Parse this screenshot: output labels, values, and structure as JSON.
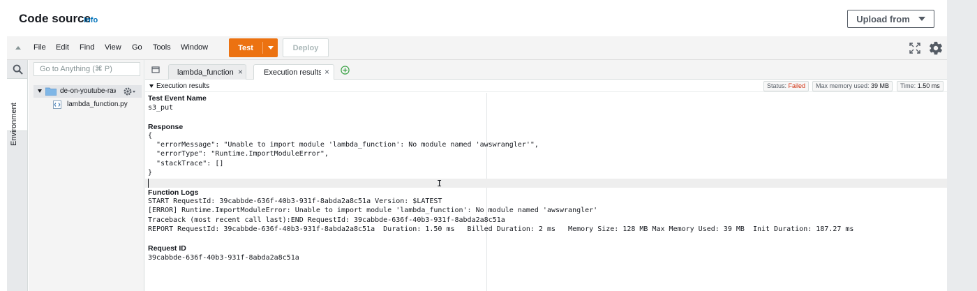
{
  "header": {
    "title": "Code source",
    "info": "Info",
    "upload_label": "Upload from"
  },
  "menubar": {
    "items": [
      "File",
      "Edit",
      "Find",
      "View",
      "Go",
      "Tools",
      "Window"
    ],
    "test_label": "Test",
    "deploy_label": "Deploy"
  },
  "sidebar": {
    "environment_label": "Environment",
    "goto_placeholder": "Go to Anything (⌘ P)",
    "folder_name": "de-on-youtube-raw-",
    "file_name": "lambda_function.py"
  },
  "tabs": [
    {
      "label": "lambda_function"
    },
    {
      "label": "Execution results"
    }
  ],
  "results": {
    "title": "Execution results",
    "status_label": "Status:",
    "status_value": "Failed",
    "memory_label": "Max memory used:",
    "memory_value": "39 MB",
    "time_label": "Time:",
    "time_value": "1.50 ms"
  },
  "output": {
    "test_event_heading": "Test Event Name",
    "test_event_value": "s3_put",
    "response_heading": "Response",
    "response_lines": [
      "{",
      "  \"errorMessage\": \"Unable to import module 'lambda_function': No module named 'awswrangler'\",",
      "  \"errorType\": \"Runtime.ImportModuleError\",",
      "  \"stackTrace\": []",
      "}"
    ],
    "function_logs_heading": "Function Logs",
    "log_lines": [
      "START RequestId: 39cabbde-636f-40b3-931f-8abda2a8c51a Version: $LATEST",
      "[ERROR] Runtime.ImportModuleError: Unable to import module 'lambda_function': No module named 'awswrangler'",
      "Traceback (most recent call last):END RequestId: 39cabbde-636f-40b3-931f-8abda2a8c51a",
      "REPORT RequestId: 39cabbde-636f-40b3-931f-8abda2a8c51a  Duration: 1.50 ms   Billed Duration: 2 ms   Memory Size: 128 MB Max Memory Used: 39 MB  Init Duration: 187.27 ms"
    ],
    "request_id_heading": "Request ID",
    "request_id_value": "39cabbde-636f-40b3-931f-8abda2a8c51a"
  },
  "colors": {
    "accent": "#ec7211",
    "link": "#0073bb",
    "failed": "#d13212"
  }
}
